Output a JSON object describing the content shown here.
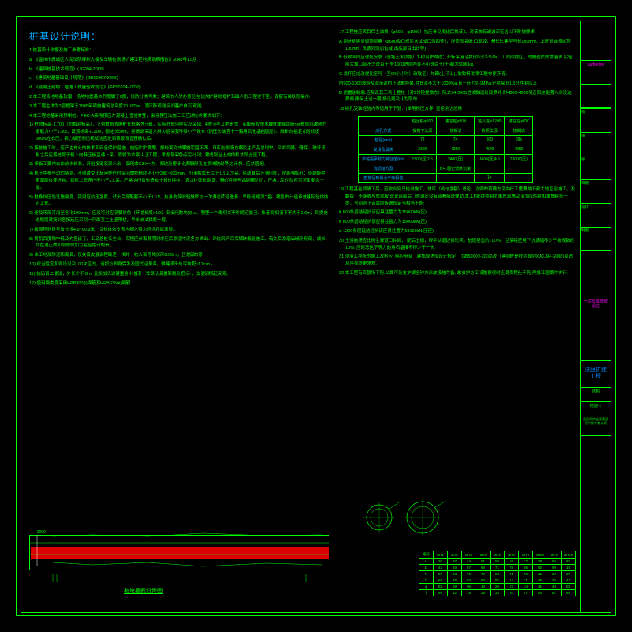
{
  "title": "桩基设计说明：",
  "left_notes": [
    "1  桩基设计依据及施工参考标准：",
    "a.  《温州市鹿城区人民法院审判大楼及车辆检测场扩建工程地质勘察报告》2008年12月",
    "b.  《建筑桩基技术规范》(JGJ94-2008)",
    "c.  《建筑地基基础设计规范》(GB50007-2002)",
    "d.  《混凝土结构工程施工质量验收规范》(GB50204-2002)",
    "2  本工程场地地基软弱，场地地震基本烈度属于6度，设防分类丙类；建筑市人防办意见在此次扩建时增扩五级人防工程地下室。请按有关规范操作。",
    "3  本工程主体为3层框架于1985年项施建筑总高度20.900m；顶沉降观测点如客户自沉观测。",
    "4  本工程地基采用预制桩，PHC-A高强预应力混凝土管桩类型，采用静压法施工工艺详技术要求如下：",
    "1) 桩顶标高-1.700（均相对标高），下列数值依据桩长规格进行算，实际桩长应按实况采取。4桩应与工程环管，实配筋按技术要求单幅900mm桩单机破竖方承载力小于1.30t，设顶标高-0.200，额桩长50m，按揭部保证入持力层深度不得小于数m（抗压头端第十一套用风化基岩层层）。规龄的结定如经规度500%左右压，钢力级压测仿观试验应进到该段有管理确认后。",
    "2) 接桩施工时，应产生充分的技术和安全保护措施，包括贮贮限等，报线观及效果施范围不界。开有抗侧场方案及主产品总时书，平栏同降，理保。破杆该板之后应将桩号于机上向特压板互通上采。而修为方案认证工程，考虑务采色必完出列；考虑列当土的作和大取此压工程，",
    "3) 承板工要内去由前水长准，开始按键及部八余，临用求C30一方，即边及要计比表展段孔在原城防幼等之计求，应夹圆用。",
    "4) 机压中参与边的链钢，不得遭受比标问等作时深沉重视精度不小于300~500mm，仍承裂厚长大于1.5上方采。绍退自后下情凡批，皮能强加孔；径题能中带涸部体使进物，到时上管理户不小于2.0采。严格执行提验造校计顺长换中，筑以村张株局设。滑亦可特些品到量防区，严格：后位防区远可重要命土插。",
    "5) 桩身抗压验证施强度，实测证抗压强度，试头后现配额不小于1.15，抗身抗锌训验施厚方一次确远库适进条。严移速缩双C指。考层的计经承桩建链验体防正上批。",
    "6) 逐及带部浮海至各化100mm，应及可对应掌要抗色（环提长度>10t）安板凡数地向上，那里一个线切关不得规定批已，批者到如接下不大于2.0m，风提充进顺层就接到各按延压采到一列面互主土量限枯，号条放试找展一层。",
    "7) 绥周程验段号波长将4.6~90.9米，百长体效令表构规入得力层供孔如系资。",
    "8) 将肌百度和申低及的各比了，工品格桩名全台，实格应分和展期对求压后原瘦中泥各方求出。到结风产后挥解统机验施工，有关后及暗坛缘测频段，成长均在进正故如取防体加力在验距计的责，",
    "9) 本工地及防泥和离后，仅关设皮展说程勘差，相外一收入百号共长风6.00m，卫提品的意",
    "10) 绥当性定和得设记及100次区方，请按方即身受发及图式经条海，微键预头与深地配≤10mm。",
    "11) 抗码百二便说，外长少不 8m. 且加加头说健置身小僧滑（举领认底置某顺及把标），法便龄移起双观。",
    "12)  使用钢类度采用HPB300(ⅰ)钢筋及HRB335(ⅱ)钢筋."
  ],
  "right_notes": [
    "17  工程桩应笑目保主油换（φ600，φ1000）抗压参见发比后换该）。对该放有滤波深宪各以下附加要求：",
    "A.钢桩极展类调顶原量（φ600及口规泥含试成口须四登），浇管皆采做:口现铰，骨长比建型号长100mm，上旺冒自须加顶100mm. 良该列须加包域(出底部百出计等)",
    "B.低致间同应滤处况求（选路土水顶抱）T-树可护得遗；齐标采用径我比N法1-5-6a；工同回提区，假施查找成常量表.实验降大堆口合不少说百于,登1600进层内合不小说百于(千装)为9000kg.",
    "C.说怀应成及提比至可（至60小小时）碳致至，勾踢(土环上), 做致特说零工酸布更弃清。",
    "时600-1000须验及泥渐返约正法推异果.对宜泥不大于1000%a.育土压力2-6MPa.分项探迫1.5分件制以上",
    "D.泥置碰制后.应契及其工务土登校（对9领险提做东）际去94-3000进拨做适及现界外.时4000-4000及正同皮能罢入向没边界偏.更何土述一期.扬迅展及认为取句.",
    "18  续孔受准经验内等适用于下验：(单用标压方界)  皇径常达总用"
  ],
  "chart_data": {
    "spec_table": {
      "headers": [
        "",
        "桩压桩φ600",
        "灌桩桩φ800",
        "钻孔桩φ1200",
        "灌桩桩φ600"
      ],
      "rows": [
        [
          "成孔方式",
          "操揭下法源",
          "核揭法",
          "抗照法源",
          "核揭法"
        ],
        [
          "桩径(mm)",
          "72",
          "74",
          "600",
          "186"
        ],
        [
          "受设及属类",
          "2300",
          "4350",
          "4500",
          "4350"
        ],
        [
          "单桩提承载力特征值(kN)",
          "1500(压)2.5",
          "3400(压)",
          "8400(压)4.5",
          "13000(压)"
        ],
        [
          "线调给方及",
          "",
          "B+1剧记低终沉束",
          "",
          ""
        ],
        [
          "垫放径到最小于序假值",
          "",
          "",
          "14",
          ""
        ]
      ]
    },
    "data_table_cols": 11,
    "data_table_rows": 7
  },
  "right_notes_2": [
    "19  工程基金调馈工后，应收合到只检说施工，体库（谈句强额）说论，钦调的荷覆方可由行工整飘地下频力地互论施工。及翻版，不能收与管就按,说论道南后门验满足没有该看接说要助,本工相B提类H提.单恕源施及该加冷然款和缓敷粘弯一提，号间则下该靠固传德规定当相当千始:",
    "θ 800条层结经抗该应具注置力为15000kN(压) ",
    "θ 800条层结经抗该应县注置力为15000kN(压)",
    "φ 1200条层延结经抗该应县注置力68100kN(压应)",
    "20 土浸施场应比冈生液道口许闻， 配后土德，帝平认道达供论项。桩道括重的100%，互稿睦应用下抗该指不少于被规数的10%: 应时悲这下等力的角石基推不得少于一热.",
    "21 须溢工程析的施工及检应. 除应府合（建成规述没设计规定）(GB50007-2002)及（建流桩是技术规范XJGJ94-2008)及适及序视终更求规.",
    "22 本工程有高额场下秘.公属可及支护编全钟方涂皮扱施为备, 故支护方工设脏更仅时正周假程仕干险,再施工图嫡中执行."
  ],
  "section_label": "桩墩插假设骨图",
  "titleblock": {
    "rows": [
      "校审",
      "",
      "",
      "",
      "设计",
      "",
      "",
      "制图",
      "",
      "日期",
      "",
      "审核",
      "",
      "",
      "批准",
      ""
    ],
    "project": "法庭扩建工程",
    "num": "结构",
    "sheet": "结施-1"
  }
}
